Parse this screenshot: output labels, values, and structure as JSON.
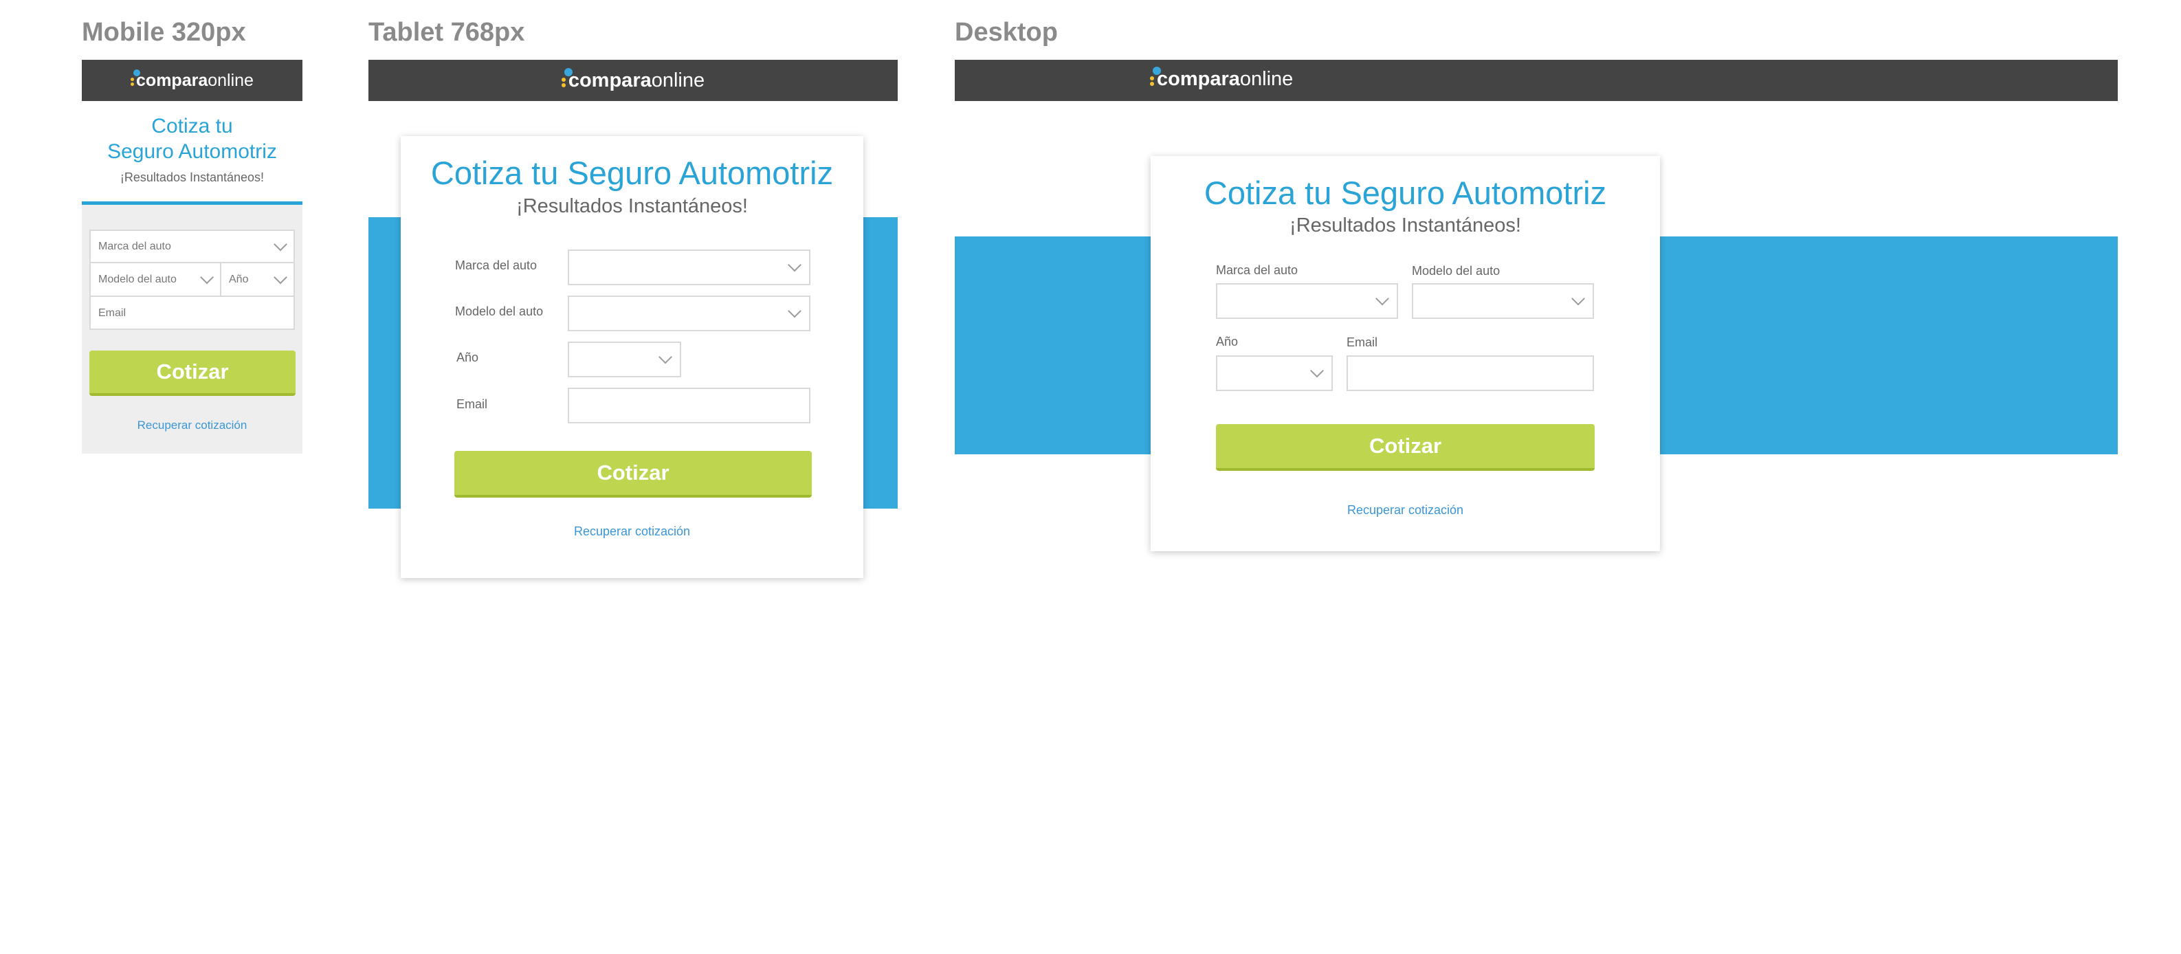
{
  "labels": {
    "mobile": "Mobile 320px",
    "tablet": "Tablet 768px",
    "desktop": "Desktop"
  },
  "brand": {
    "logo_bold": "compara",
    "logo_regular": "online",
    "colors": {
      "header_bg": "#444444",
      "accent_blue": "#2aa3d6",
      "band_blue": "#36a9dd",
      "cta_green": "#bdd54f",
      "link_blue": "#3a96d6"
    }
  },
  "form": {
    "title": "Cotiza tu Seguro Automotriz",
    "title_line1": "Cotiza tu",
    "title_line2": "Seguro Automotriz",
    "subtitle": "¡Resultados Instantáneos!",
    "brand_label": "Marca del auto",
    "model_label": "Modelo del auto",
    "year_label": "Año",
    "email_label": "Email",
    "submit_label": "Cotizar",
    "recover_link": "Recuperar cotización"
  }
}
